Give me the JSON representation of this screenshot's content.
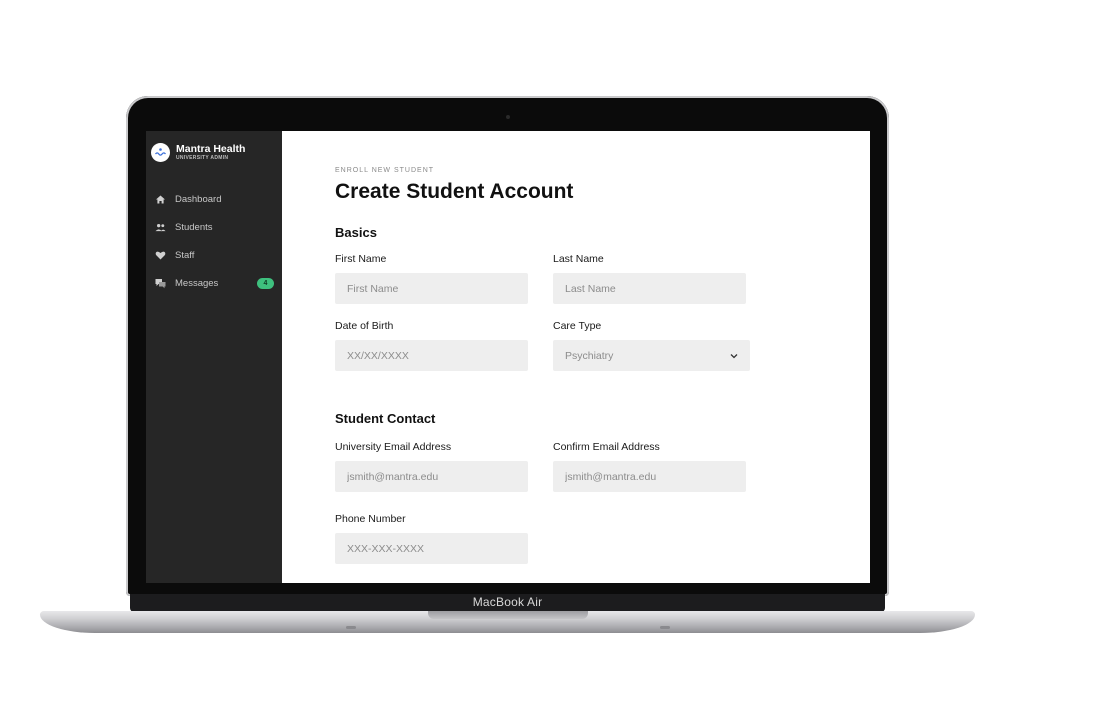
{
  "device": {
    "label": "MacBook Air"
  },
  "sidebar": {
    "brand": {
      "name": "Mantra Health",
      "subtitle": "UNIVERSITY ADMIN",
      "logo_icon": "mantra-logo-icon"
    },
    "items": [
      {
        "label": "Dashboard",
        "icon": "home-icon"
      },
      {
        "label": "Students",
        "icon": "people-icon"
      },
      {
        "label": "Staff",
        "icon": "heart-icon"
      },
      {
        "label": "Messages",
        "icon": "chat-icon",
        "badge": "4"
      }
    ],
    "badge_color": "#3ec07e",
    "background": "#262626"
  },
  "page": {
    "eyebrow": "ENROLL NEW STUDENT",
    "title": "Create Student Account"
  },
  "basics": {
    "heading": "Basics",
    "first_name": {
      "label": "First Name",
      "placeholder": "First Name"
    },
    "last_name": {
      "label": "Last Name",
      "placeholder": "Last Name"
    },
    "dob": {
      "label": "Date of Birth",
      "placeholder": "XX/XX/XXXX"
    },
    "care_type": {
      "label": "Care Type",
      "value": "Psychiatry"
    }
  },
  "contact": {
    "heading": "Student Contact",
    "email": {
      "label": "University Email Address",
      "placeholder": "jsmith@mantra.edu"
    },
    "confirm_email": {
      "label": "Confirm Email Address",
      "placeholder": "jsmith@mantra.edu"
    },
    "phone": {
      "label": "Phone Number",
      "placeholder": "XXX-XXX-XXXX"
    }
  }
}
